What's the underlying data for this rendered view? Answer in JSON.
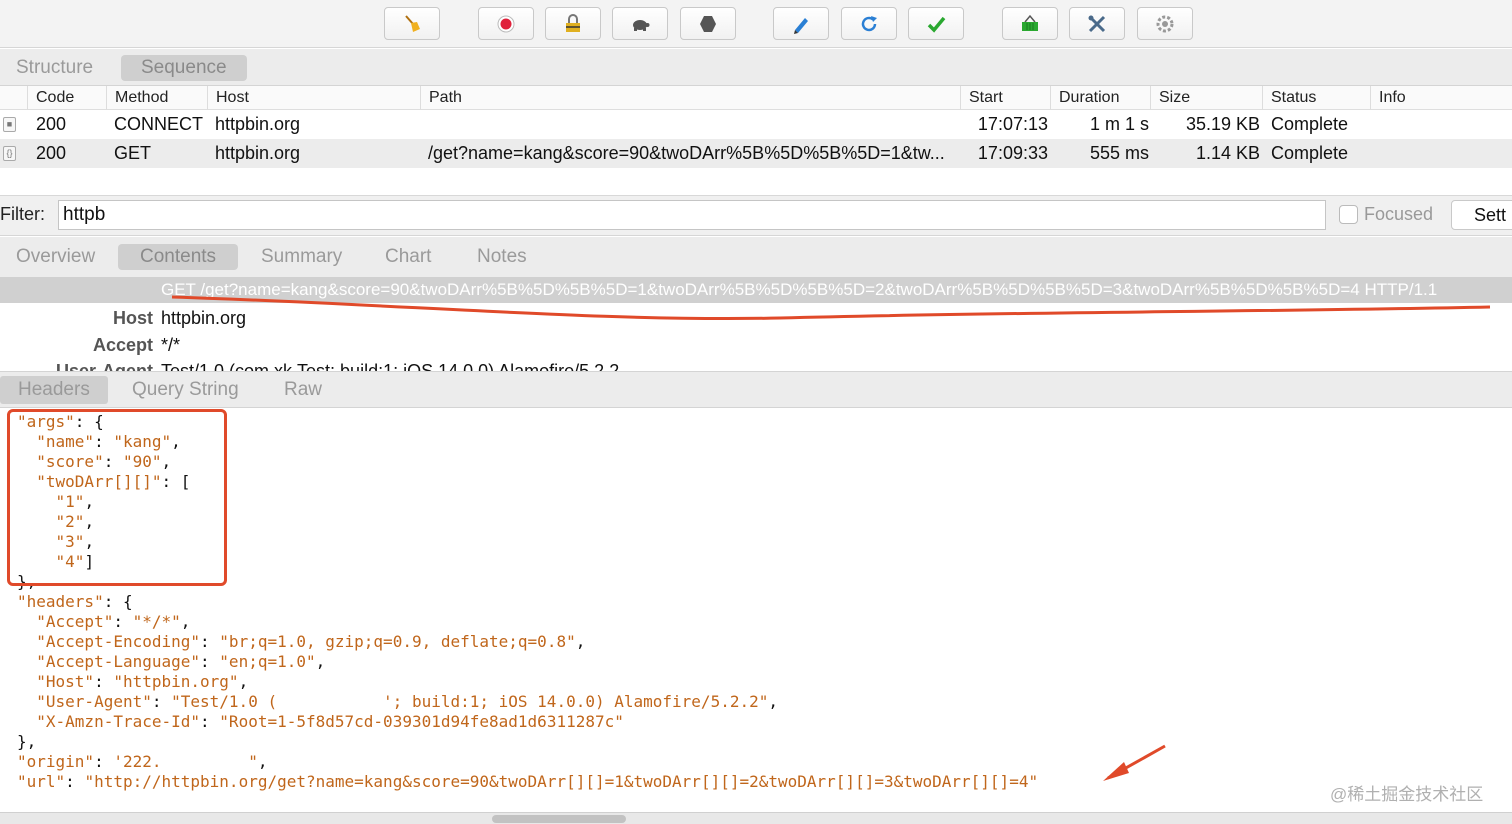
{
  "toolbar": {
    "buttons": [
      {
        "name": "broom-icon",
        "color": "#e0a020"
      },
      {
        "name": "record-icon",
        "color": "#e0203a"
      },
      {
        "name": "ssl-lock-icon",
        "color": "#c8a020"
      },
      {
        "name": "throttle-turtle-icon",
        "color": "#555555"
      },
      {
        "name": "stop-hexagon-icon",
        "color": "#555555"
      },
      {
        "name": "compose-pen-icon",
        "color": "#2a7fd4"
      },
      {
        "name": "repeat-icon",
        "color": "#2a7fd4"
      },
      {
        "name": "validate-check-icon",
        "color": "#2aa830"
      },
      {
        "name": "basket-icon",
        "color": "#2aa830"
      },
      {
        "name": "tools-icon",
        "color": "#4a6a8a"
      },
      {
        "name": "settings-gear-icon",
        "color": "#888888"
      }
    ]
  },
  "view_tabs": {
    "structure": "Structure",
    "sequence": "Sequence"
  },
  "table": {
    "columns": [
      "Code",
      "Method",
      "Host",
      "Path",
      "Start",
      "Duration",
      "Size",
      "Status",
      "Info"
    ],
    "rows": [
      {
        "code": "200",
        "method": "CONNECT",
        "host": "httpbin.org",
        "path": "",
        "start": "17:07:13",
        "duration": "1 m 1 s",
        "size": "35.19 KB",
        "status": "Complete",
        "info": ""
      },
      {
        "code": "200",
        "method": "GET",
        "host": "httpbin.org",
        "path": "/get?name=kang&score=90&twoDArr%5B%5D%5B%5D=1&tw...",
        "start": "17:09:33",
        "duration": "555 ms",
        "size": "1.14 KB",
        "status": "Complete",
        "info": ""
      }
    ]
  },
  "filter": {
    "label": "Filter:",
    "value": "httpb",
    "focused_label": "Focused",
    "settings_label": "Sett"
  },
  "detail_tabs": {
    "overview": "Overview",
    "contents": "Contents",
    "summary": "Summary",
    "chart": "Chart",
    "notes": "Notes"
  },
  "request": {
    "line": "GET /get?name=kang&score=90&twoDArr%5B%5D%5B%5D=1&twoDArr%5B%5D%5B%5D=2&twoDArr%5B%5D%5B%5D=3&twoDArr%5B%5D%5B%5D=4 HTTP/1.1",
    "headers": [
      {
        "name": "Host",
        "value": "httpbin.org"
      },
      {
        "name": "Accept",
        "value": "*/*"
      },
      {
        "name": "User-Agent",
        "value": "Test/1.0 (com.xk.Test; build:1; iOS 14.0.0) Alamofire/5.2.2"
      }
    ]
  },
  "response_tabs": {
    "headers": "Headers",
    "query": "Query String",
    "raw": "Raw"
  },
  "json_lines": [
    {
      "k": "\"args\"",
      "p": ": {"
    },
    {
      "k": "  \"name\"",
      "p": ": ",
      "v": "\"kang\"",
      "t": ","
    },
    {
      "k": "  \"score\"",
      "p": ": ",
      "v": "\"90\"",
      "t": ","
    },
    {
      "k": "  \"twoDArr[][]\"",
      "p": ": ["
    },
    {
      "v": "    \"1\"",
      "t": ","
    },
    {
      "v": "    \"2\"",
      "t": ","
    },
    {
      "v": "    \"3\"",
      "t": ","
    },
    {
      "v": "    \"4\"",
      "t": "]"
    },
    {
      "p": "},"
    },
    {
      "k": "\"headers\"",
      "p": ": {"
    },
    {
      "k": "  \"Accept\"",
      "p": ": ",
      "v": "\"*/*\"",
      "t": ","
    },
    {
      "k": "  \"Accept-Encoding\"",
      "p": ": ",
      "v": "\"br;q=1.0, gzip;q=0.9, deflate;q=0.8\"",
      "t": ","
    },
    {
      "k": "  \"Accept-Language\"",
      "p": ": ",
      "v": "\"en;q=1.0\"",
      "t": ","
    },
    {
      "k": "  \"Host\"",
      "p": ": ",
      "v": "\"httpbin.org\"",
      "t": ","
    },
    {
      "k": "  \"User-Agent\"",
      "p": ": ",
      "v": "\"Test/1.0 (           '; build:1; iOS 14.0.0) Alamofire/5.2.2\"",
      "t": ","
    },
    {
      "k": "  \"X-Amzn-Trace-Id\"",
      "p": ": ",
      "v": "\"Root=1-5f8d57cd-039301d94fe8ad1d6311287c\""
    },
    {
      "p": "},"
    },
    {
      "k": "\"origin\"",
      "p": ": ",
      "v": "'222.         \"",
      "t": ","
    },
    {
      "k": "\"url\"",
      "p": ": ",
      "v": "\"http://httpbin.org/get?name=kang&score=90&twoDArr[][]=1&twoDArr[][]=2&twoDArr[][]=3&twoDArr[][]=4\""
    }
  ],
  "watermark": "@稀土掘金技术社区"
}
